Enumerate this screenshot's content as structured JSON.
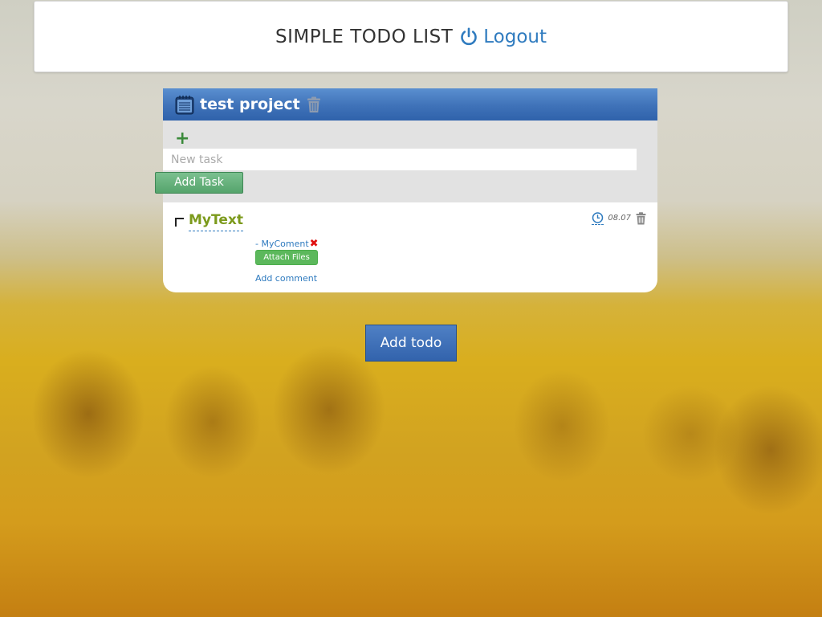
{
  "header": {
    "title": "SIMPLE TODO LIST",
    "logout_label": "Logout",
    "logout_icon": "power-icon"
  },
  "project": {
    "name": "test project",
    "icon": "notepad-icon",
    "delete_icon": "trash-icon",
    "add_icon": "plus-icon",
    "new_task": {
      "placeholder": "New task",
      "value": ""
    },
    "add_task_label": "Add Task",
    "tasks": [
      {
        "title": "MyText",
        "done": false,
        "deadline": "08.07",
        "deadline_icon": "clock-icon",
        "delete_icon": "trash-icon",
        "comments": [
          {
            "text": "- MyComent",
            "delete_symbol": "✖"
          }
        ],
        "attach_label": "Attach Files",
        "add_comment_label": "Add comment"
      }
    ]
  },
  "add_todo_label": "Add todo",
  "colors": {
    "accent_blue": "#2f7bbf",
    "header_blue": "#3f72b8",
    "task_title_green": "#7c9a1c",
    "button_green": "#5cb85c",
    "delete_red": "#e01010"
  }
}
